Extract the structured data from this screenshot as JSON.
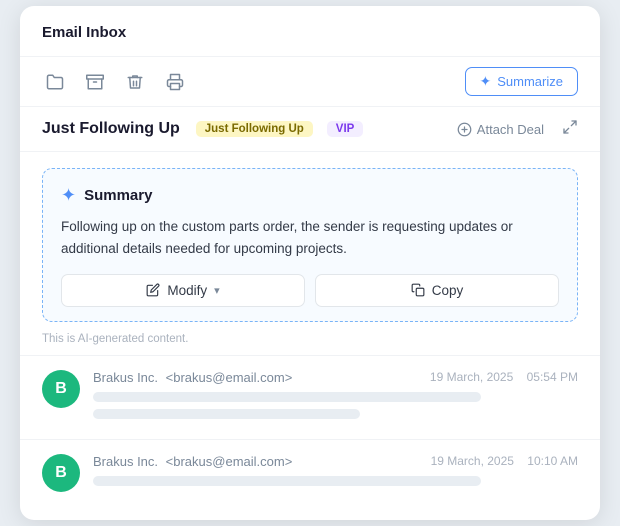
{
  "card": {
    "title": "Email Inbox"
  },
  "toolbar": {
    "summarize_label": "Summarize",
    "icons": [
      {
        "name": "folder-icon",
        "symbol": "🗂"
      },
      {
        "name": "archive-icon",
        "symbol": "⊟"
      },
      {
        "name": "trash-icon",
        "symbol": "🗑"
      },
      {
        "name": "print-icon",
        "symbol": "🖨"
      }
    ]
  },
  "subject": {
    "title": "Just Following Up",
    "tag1": "Just Following Up",
    "tag2": "VIP",
    "attach_deal": "Attach Deal",
    "expand": "⤢"
  },
  "summary": {
    "heading": "Summary",
    "body": "Following up on the custom  parts order, the sender is requesting updates or additional details needed for upcoming projects.",
    "modify_label": "Modify",
    "copy_label": "Copy",
    "ai_note": "This is AI-generated content."
  },
  "emails": [
    {
      "avatar": "B",
      "from": "Brakus Inc.",
      "email": "<brakus@email.com>",
      "date": "19 March, 2025",
      "time": "05:54 PM"
    },
    {
      "avatar": "B",
      "from": "Brakus Inc.",
      "email": "<brakus@email.com>",
      "date": "19 March, 2025",
      "time": "10:10 AM"
    }
  ]
}
